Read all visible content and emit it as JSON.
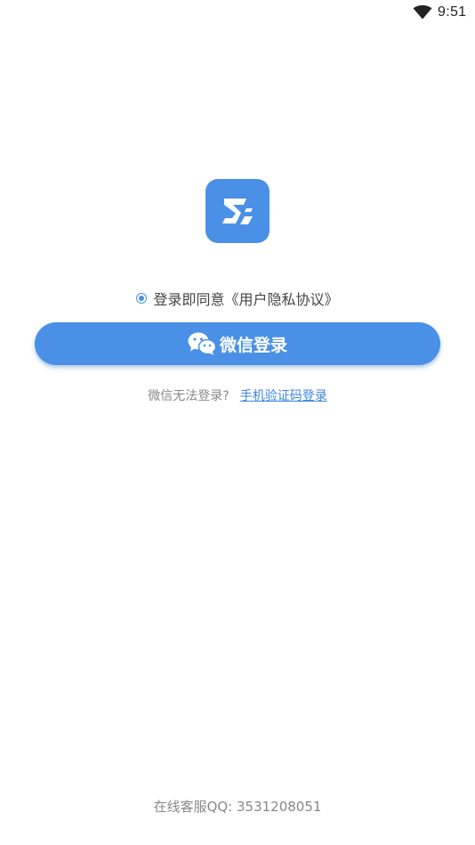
{
  "status_bar": {
    "time": "9:51",
    "wifi_icon": "wifi-icon"
  },
  "logo": {
    "icon": "app-logo-icon",
    "color": "#4a90e6"
  },
  "agreement": {
    "checked": true,
    "text": "登录即同意《用户隐私协议》"
  },
  "wechat_login": {
    "icon": "wechat-icon",
    "label": "微信登录",
    "color": "#4a90e6"
  },
  "alternative": {
    "prompt": "微信无法登录?",
    "link": "手机验证码登录"
  },
  "footer": {
    "support": "在线客服QQ: 3531208051"
  }
}
